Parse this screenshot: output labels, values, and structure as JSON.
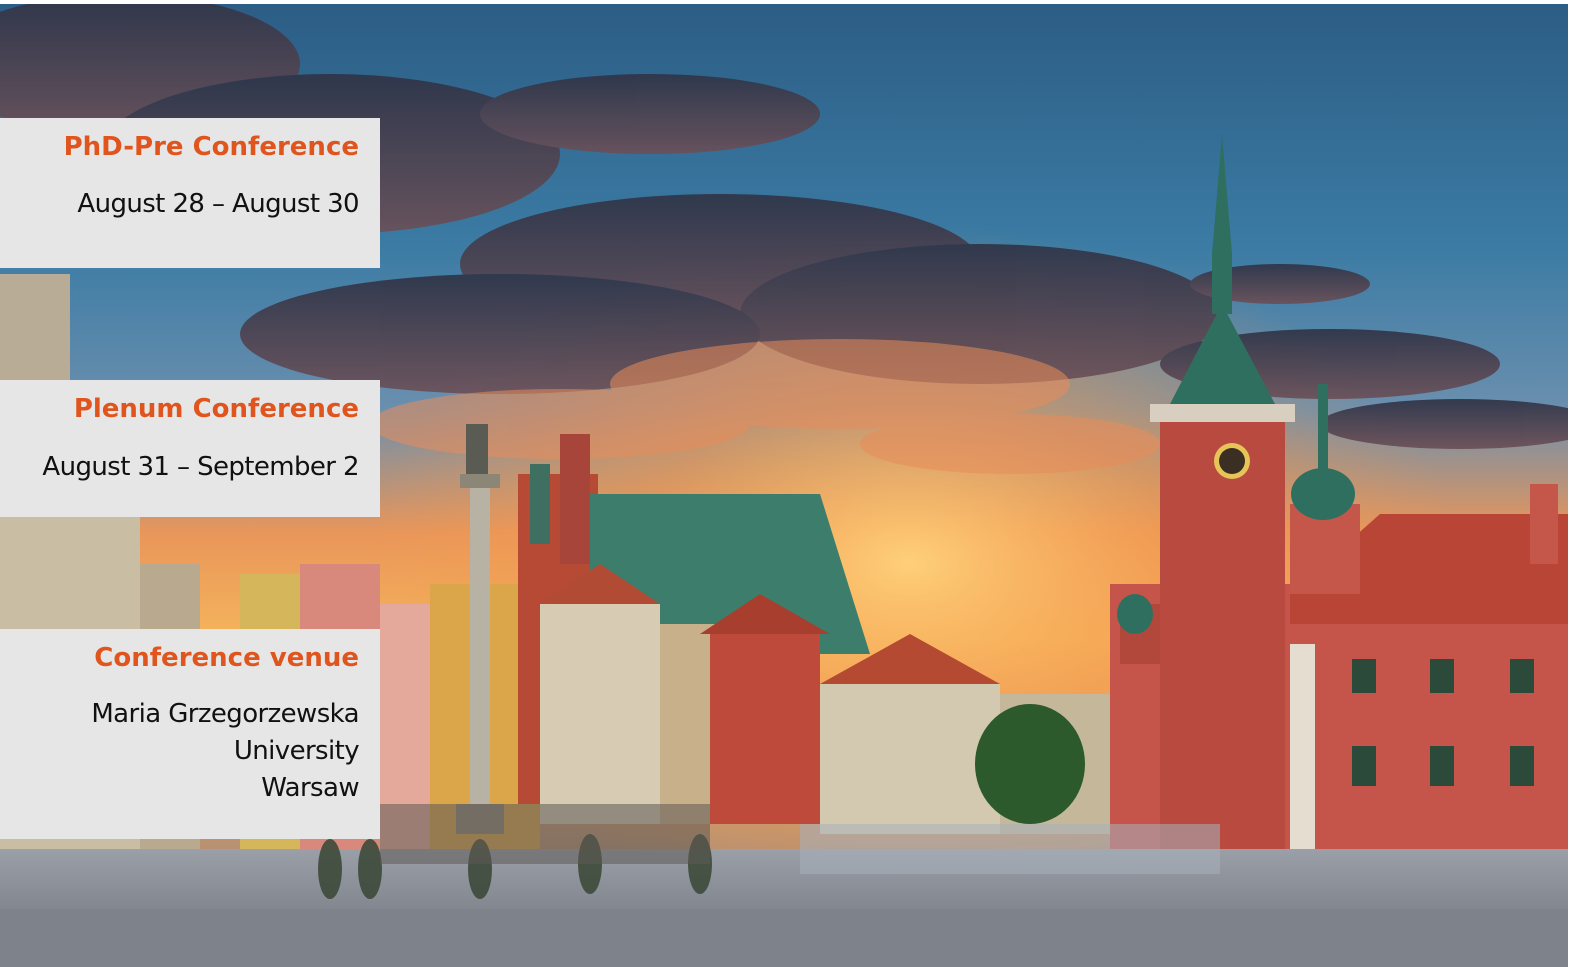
{
  "hero": {
    "scene": "warsaw-castle-square"
  },
  "cards": {
    "phd": {
      "title": "PhD-Pre Conference",
      "dates": "August 28 – August 30"
    },
    "plenum": {
      "title": "Plenum Conference",
      "dates": "August 31 – September 2"
    },
    "venue": {
      "title": "Conference venue",
      "lines": [
        "Maria Grzegorzewska",
        "University",
        "Warsaw"
      ]
    }
  },
  "colors": {
    "accent": "#e0551d",
    "card_background": "#e6e6e6",
    "text": "#111111"
  }
}
